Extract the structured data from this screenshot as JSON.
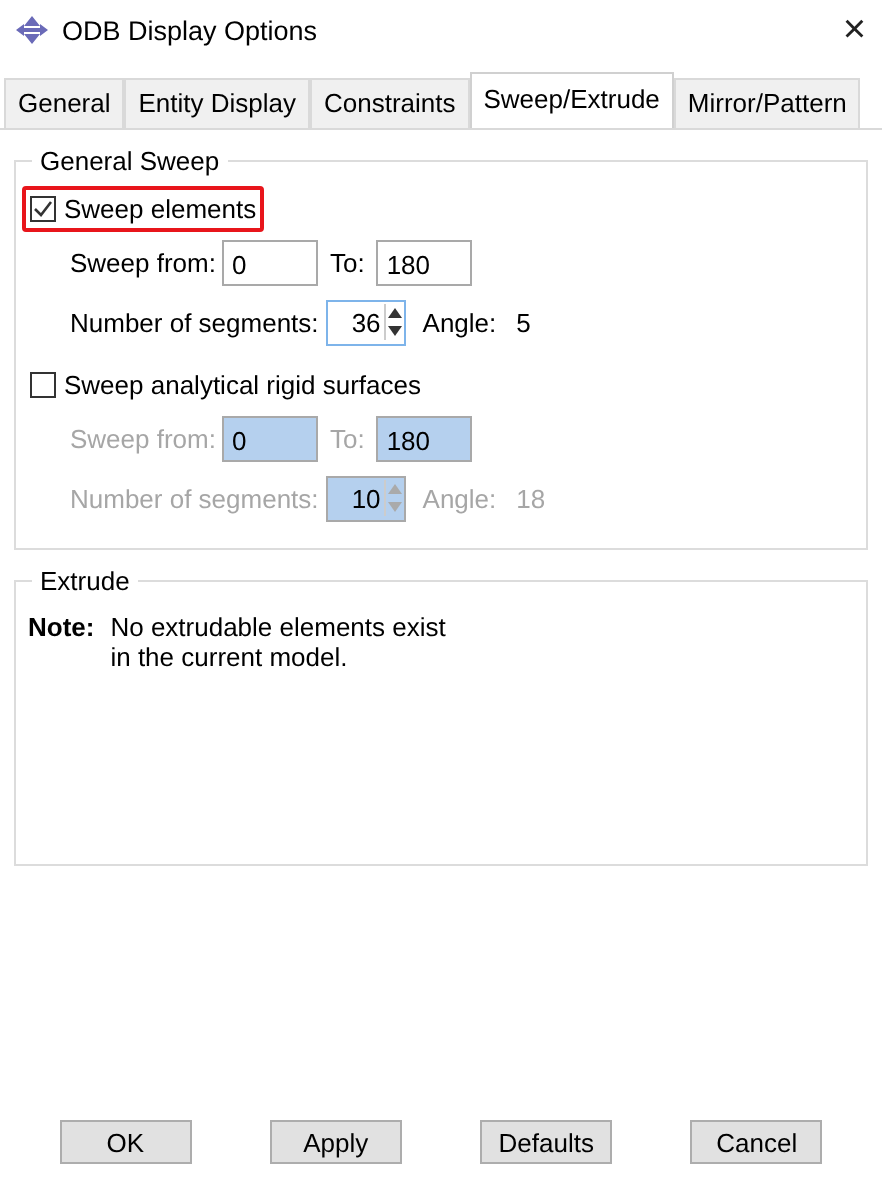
{
  "window": {
    "title": "ODB Display Options",
    "close": "×"
  },
  "tabs": [
    {
      "label": "General",
      "selected": false
    },
    {
      "label": "Entity Display",
      "selected": false
    },
    {
      "label": "Constraints",
      "selected": false
    },
    {
      "label": "Sweep/Extrude",
      "selected": true
    },
    {
      "label": "Mirror/Pattern",
      "selected": false
    }
  ],
  "general_sweep": {
    "title": "General Sweep",
    "options": [
      {
        "label": "Sweep elements",
        "checked": true,
        "highlighted": true,
        "disabled": false,
        "sweep_from_label": "Sweep from:",
        "sweep_from": "0",
        "to_label": "To:",
        "to": "180",
        "segments_label": "Number of segments:",
        "segments": "36",
        "angle_label": "Angle:",
        "angle": "5"
      },
      {
        "label": "Sweep analytical rigid surfaces",
        "checked": false,
        "highlighted": false,
        "disabled": true,
        "sweep_from_label": "Sweep from:",
        "sweep_from": "0",
        "to_label": "To:",
        "to": "180",
        "segments_label": "Number of segments:",
        "segments": "10",
        "angle_label": "Angle:",
        "angle": "18"
      }
    ]
  },
  "extrude": {
    "title": "Extrude",
    "note_label": "Note:",
    "note": "No extrudable elements exist in the current model."
  },
  "buttons": [
    "OK",
    "Apply",
    "Defaults",
    "Cancel"
  ]
}
